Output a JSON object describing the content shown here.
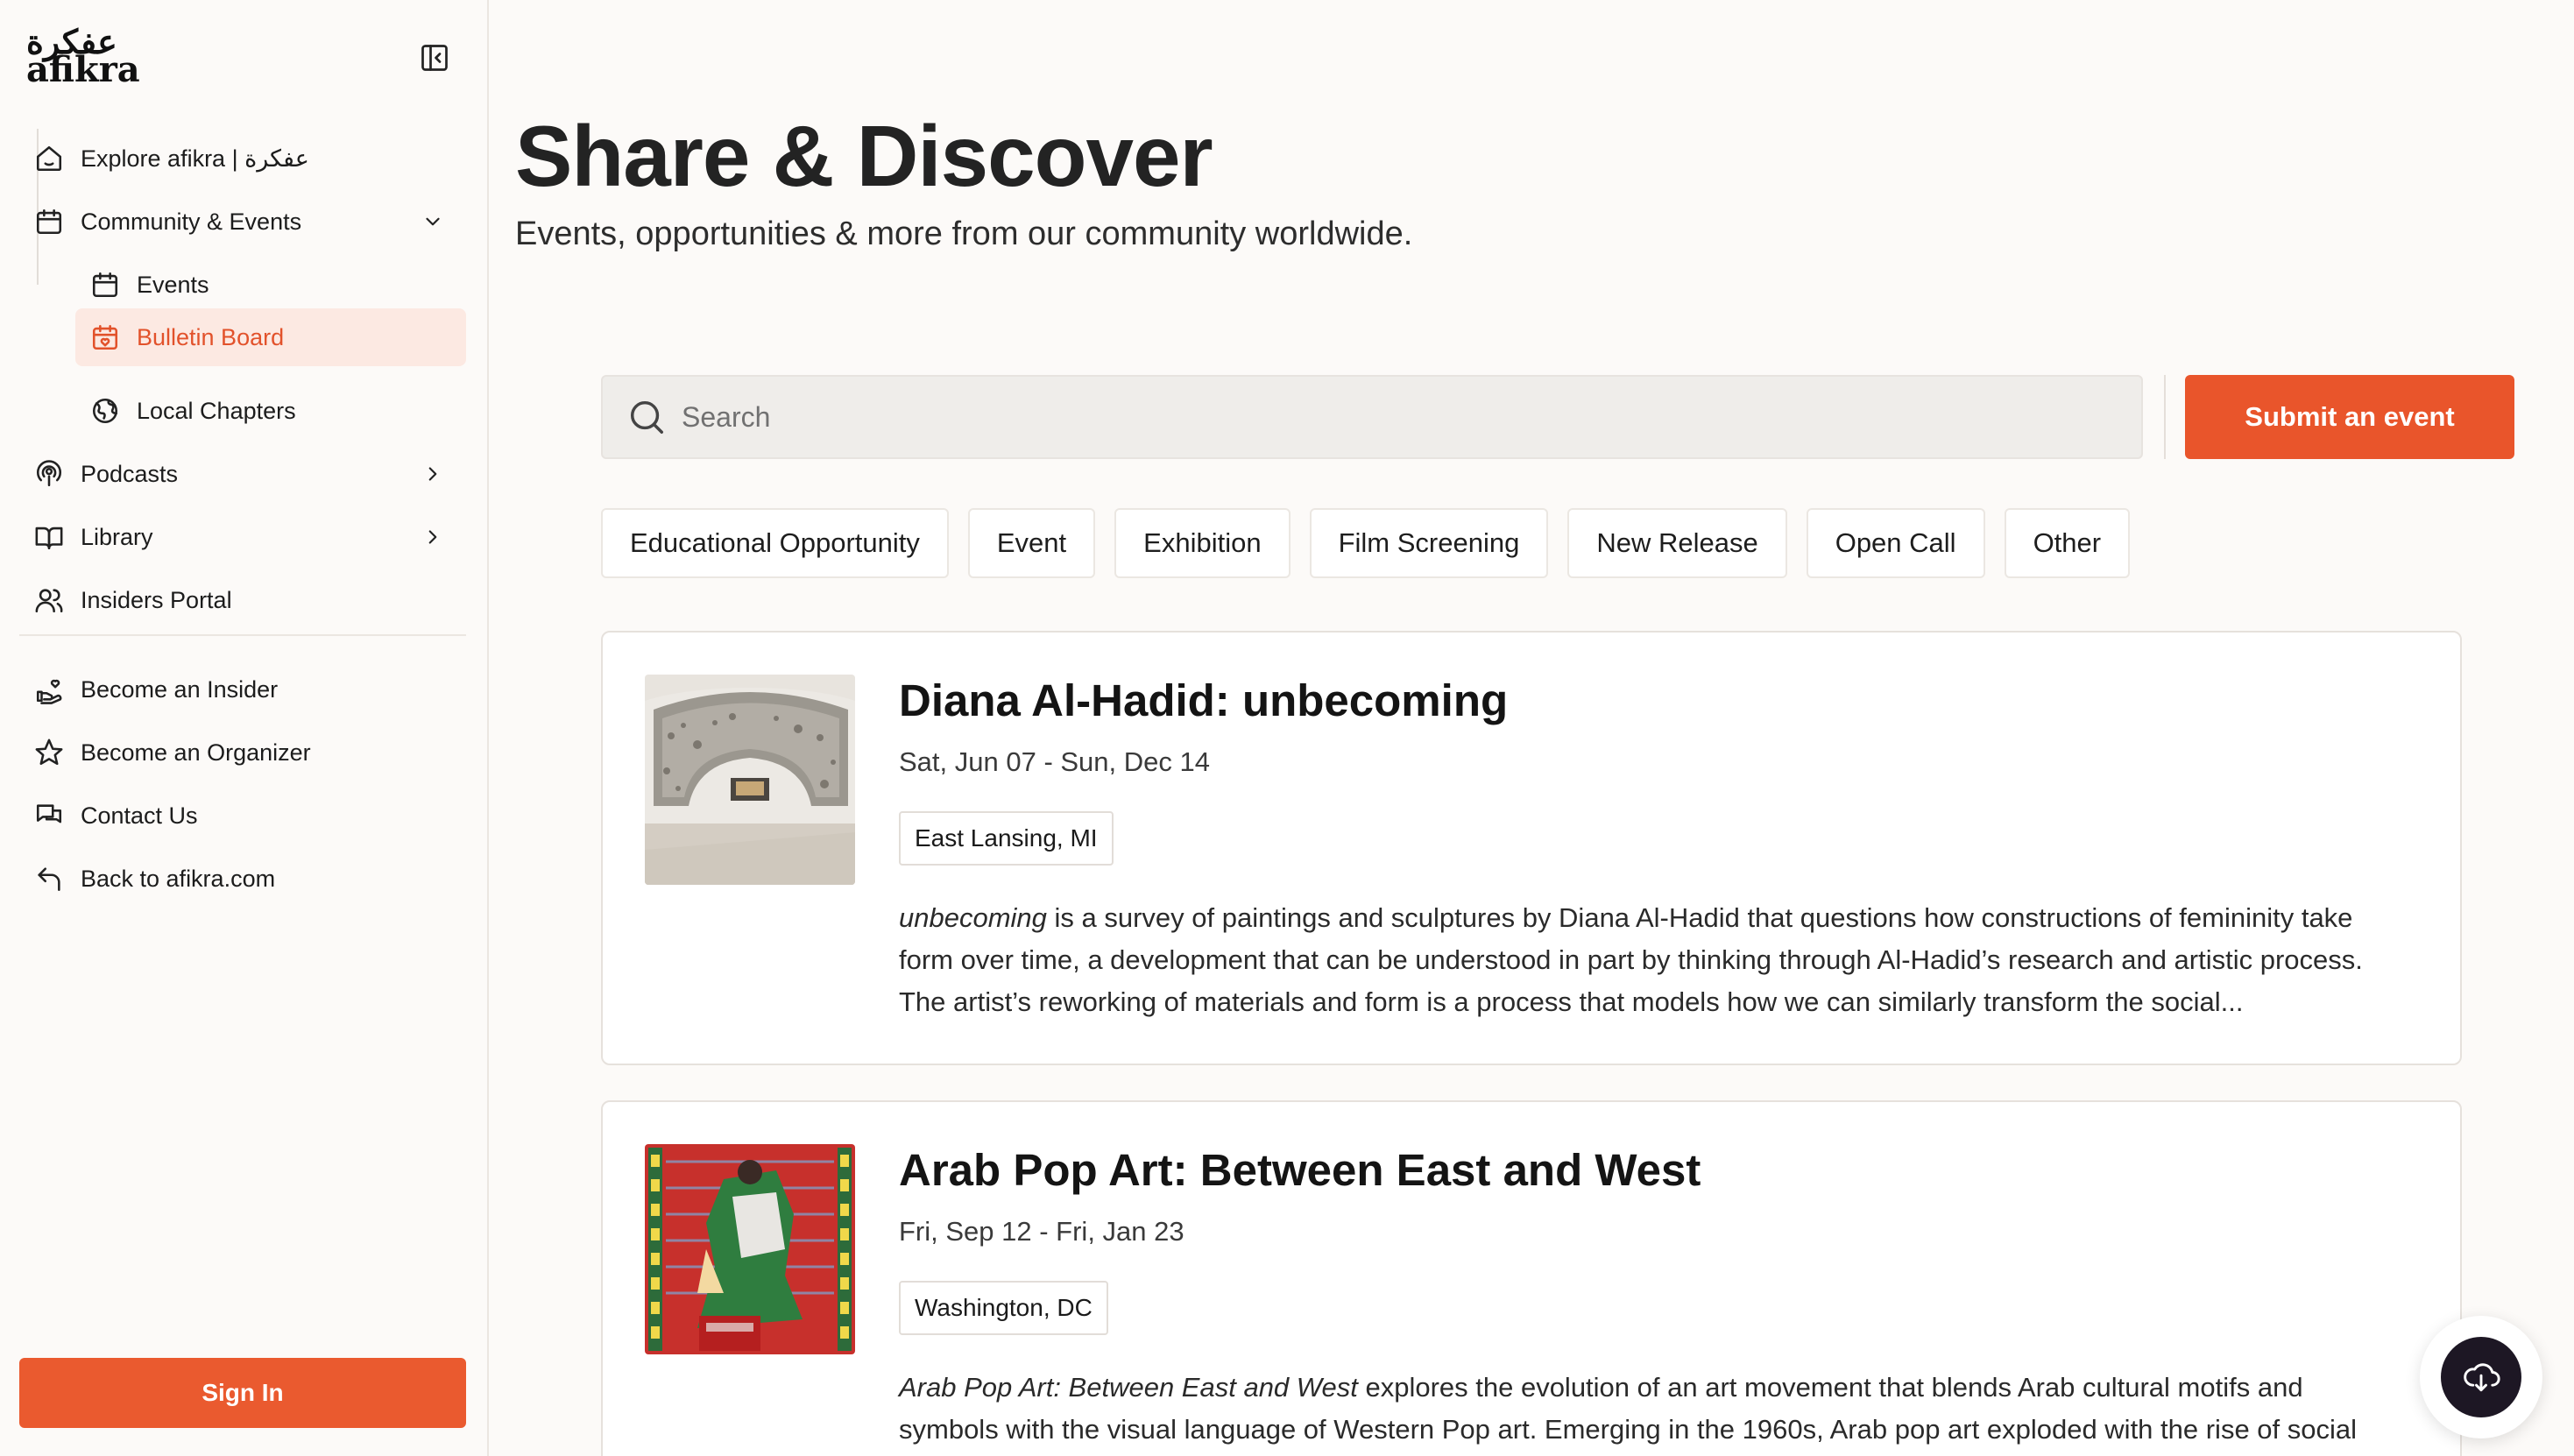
{
  "brand": {
    "logo_arabic": "عفكرة",
    "logo_latin": "afikra"
  },
  "sidebar": {
    "items": [
      {
        "label": "Explore afikra | عفكرة",
        "icon": "home-icon"
      },
      {
        "label": "Community & Events",
        "icon": "calendar-icon",
        "expanded": true
      },
      {
        "label": "Events",
        "icon": "calendar-icon"
      },
      {
        "label": "Bulletin Board",
        "icon": "calendar-heart-icon",
        "active": true
      },
      {
        "label": "Local Chapters",
        "icon": "globe-icon"
      },
      {
        "label": "Podcasts",
        "icon": "podcast-icon"
      },
      {
        "label": "Library",
        "icon": "book-icon"
      },
      {
        "label": "Insiders Portal",
        "icon": "users-icon"
      }
    ],
    "secondary": [
      {
        "label": "Become an Insider",
        "icon": "hand-heart-icon"
      },
      {
        "label": "Become an Organizer",
        "icon": "star-icon"
      },
      {
        "label": "Contact Us",
        "icon": "chat-icon"
      },
      {
        "label": "Back to afikra.com",
        "icon": "undo-arrow-icon"
      }
    ],
    "sign_in_label": "Sign In"
  },
  "main": {
    "title": "Share & Discover",
    "subtitle": "Events, opportunities & more from our community worldwide.",
    "search": {
      "placeholder": "Search",
      "value": ""
    },
    "submit_label": "Submit an event",
    "filters": [
      "Educational Opportunity",
      "Event",
      "Exhibition",
      "Film Screening",
      "New Release",
      "Open Call",
      "Other"
    ],
    "cards": [
      {
        "title": "Diana Al-Hadid: unbecoming",
        "date": "Sat, Jun 07 - Sun, Dec 14",
        "location": "East Lansing, MI",
        "desc_em": "unbecoming",
        "desc_rest": " is a survey of paintings and sculptures by Diana Al-Hadid that questions how constructions of femininity take form over time, a development that can be understood in part by thinking through Al-Hadid’s research and artistic process. The artist’s reworking of materials and form is a process that models how we can similarly transform the social..."
      },
      {
        "title": "Arab Pop Art: Between East and West",
        "date": "Fri, Sep 12 - Fri, Jan 23",
        "location": "Washington, DC",
        "desc_em": "Arab Pop Art: Between East and West",
        "desc_rest": " explores the evolution of an art movement that blends Arab cultural motifs and symbols with the visual language of Western Pop art. Emerging in the 1960s, Arab pop art exploded with the rise of social"
      }
    ]
  },
  "colors": {
    "accent": "#e9552b",
    "active_bg": "#fce9e2",
    "background": "#fcfaf8"
  }
}
